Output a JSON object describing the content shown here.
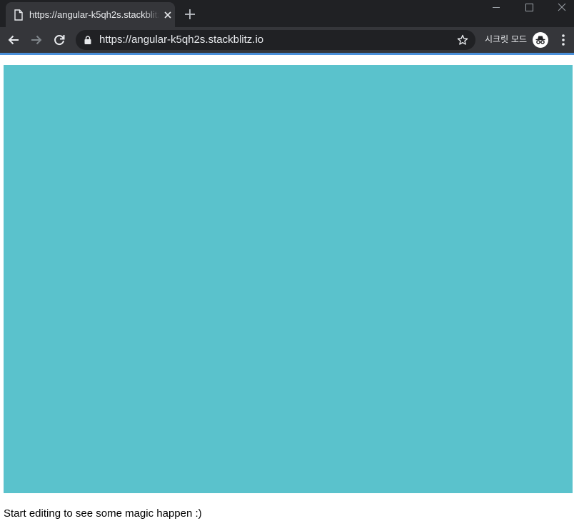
{
  "browser": {
    "tab": {
      "title": "https://angular-k5qh2s.stackblitz.io",
      "icon": "document-icon"
    },
    "address_bar": {
      "url": "https://angular-k5qh2s.stackblitz.io"
    },
    "incognito_label": "시크릿 모드",
    "colors": {
      "tabstrip": "#202124",
      "toolbar": "#35363a",
      "omnibox": "#202124",
      "text": "#e8eaed",
      "accent": "#4a8fd9"
    }
  },
  "page": {
    "box_color": "#5ac2cc",
    "message": "Start editing to see some magic happen :)"
  }
}
